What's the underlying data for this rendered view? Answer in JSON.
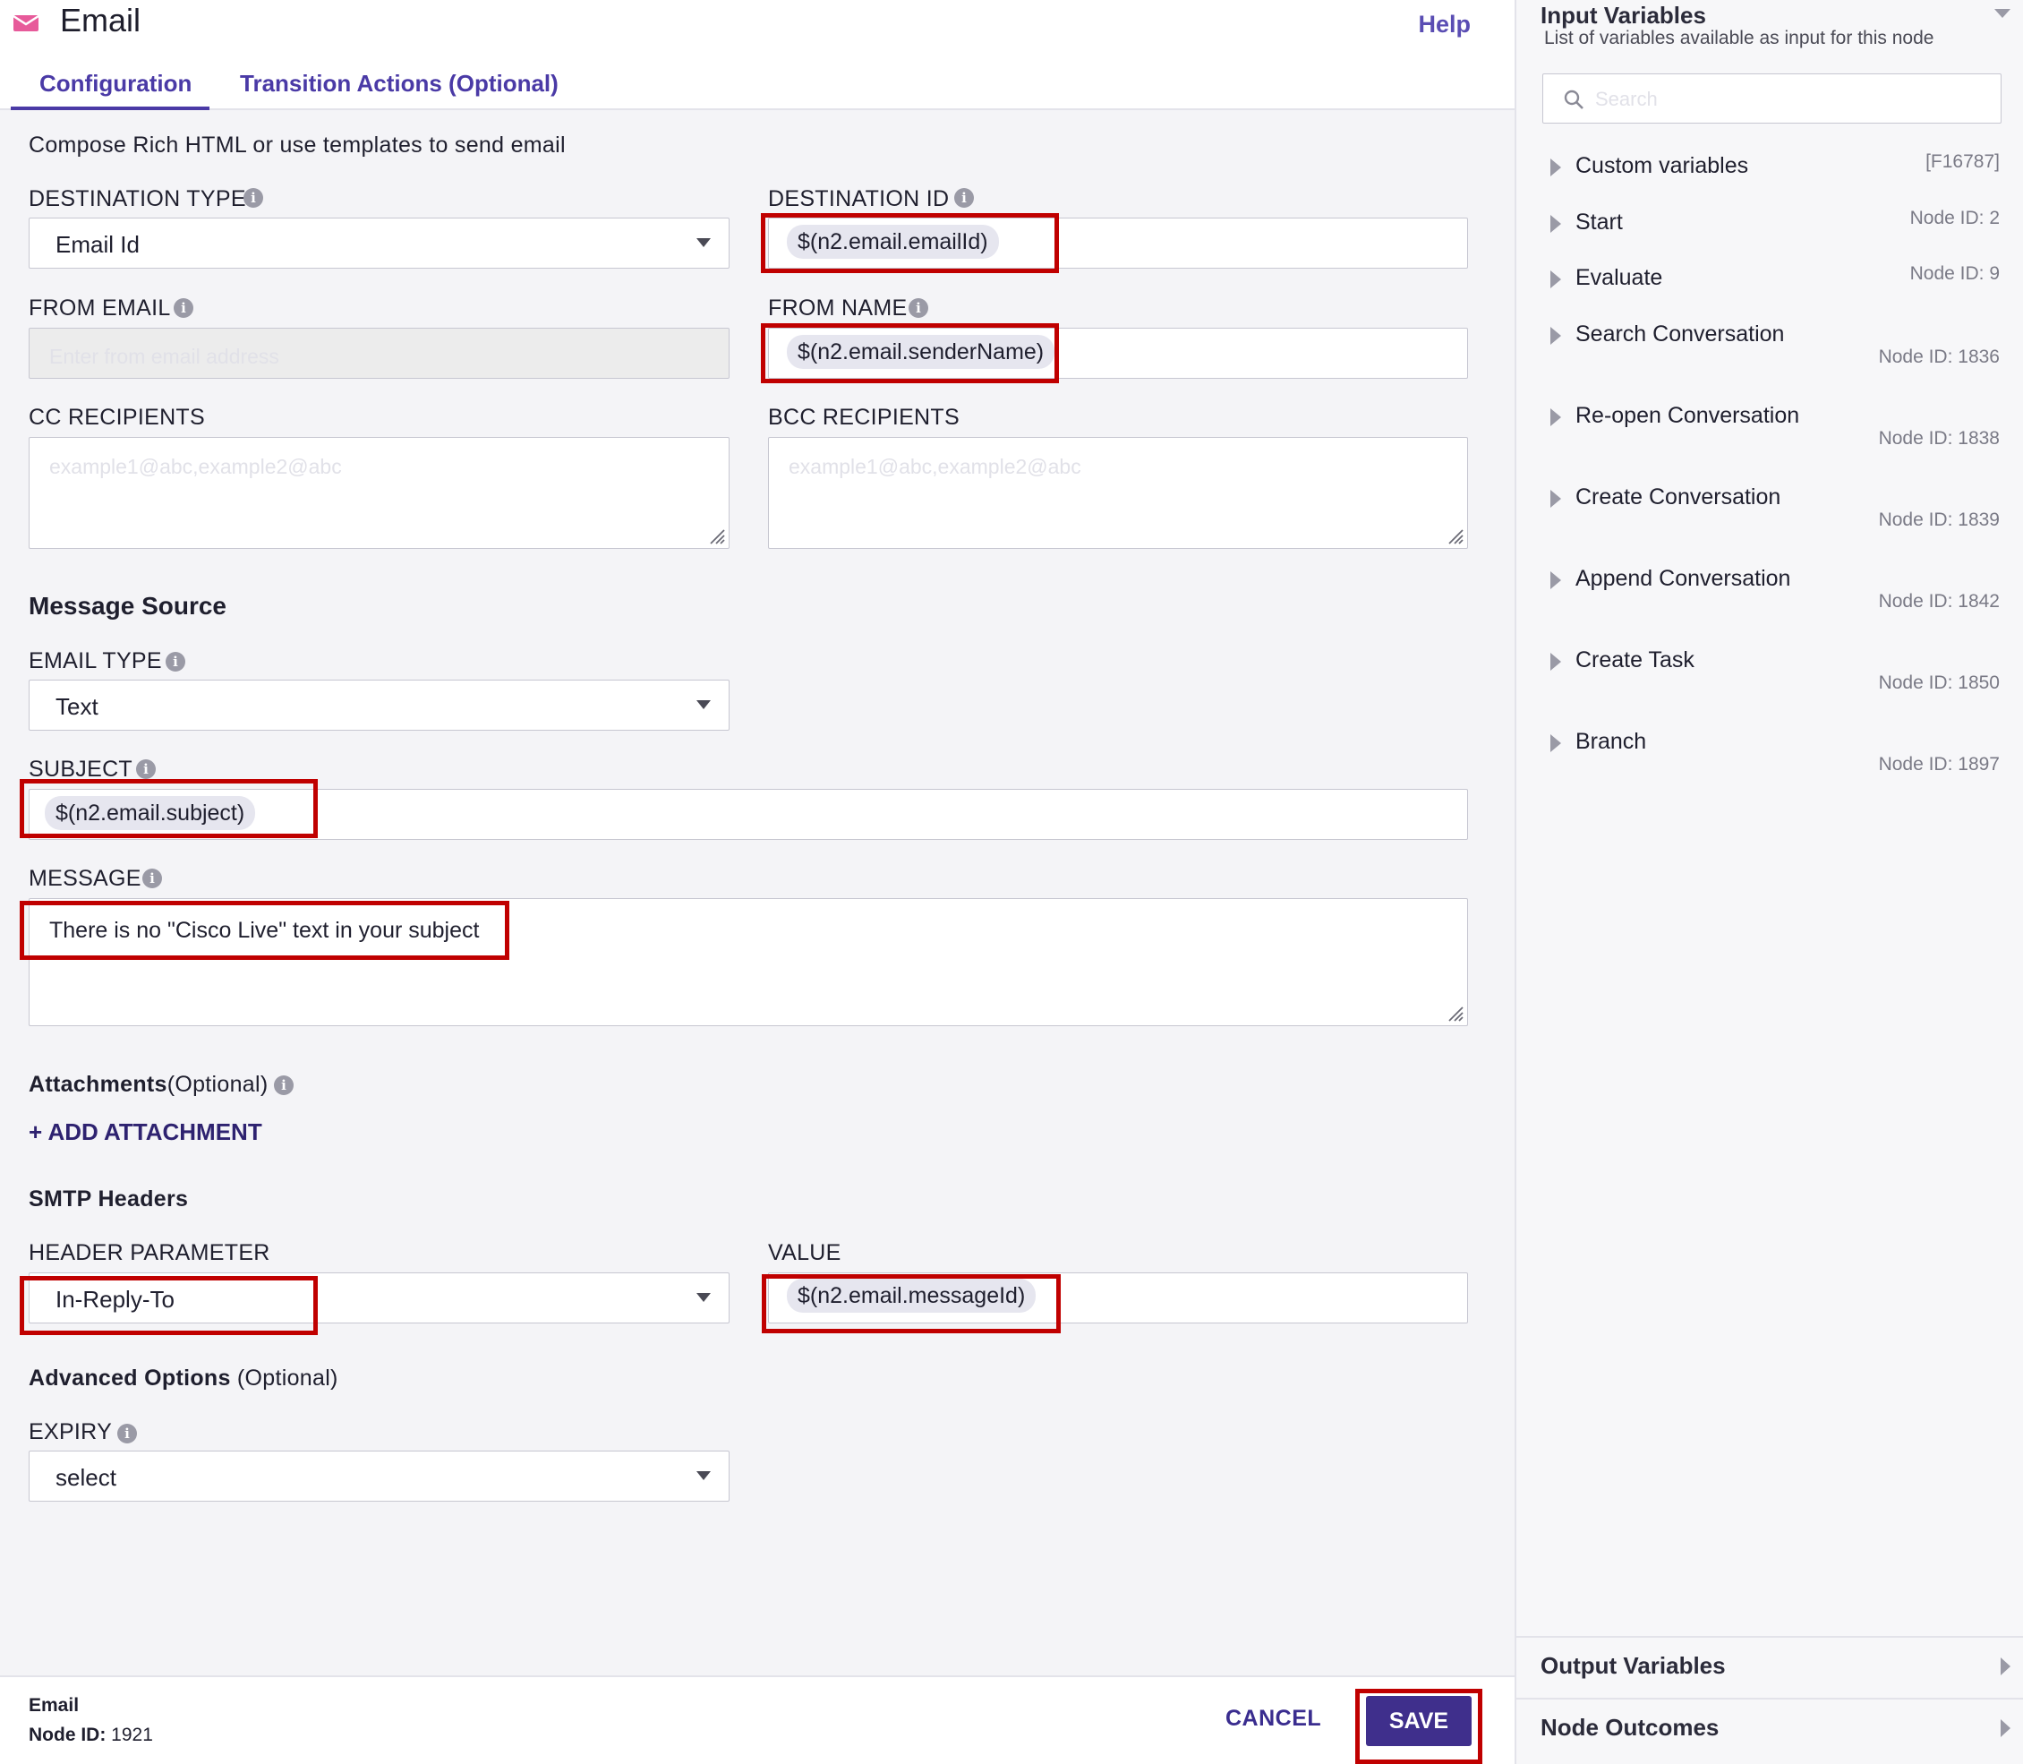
{
  "header": {
    "title": "Email",
    "help": "Help",
    "tabs": [
      "Configuration",
      "Transition Actions (Optional)"
    ]
  },
  "form": {
    "description": "Compose Rich HTML or use templates to send email",
    "destination_type": {
      "label": "DESTINATION TYPE",
      "value": "Email Id"
    },
    "destination_id": {
      "label": "DESTINATION ID",
      "value": "$(n2.email.emailId)"
    },
    "from_email": {
      "label": "FROM EMAIL",
      "placeholder": "Enter from email address"
    },
    "from_name": {
      "label": "FROM NAME",
      "value": "$(n2.email.senderName)"
    },
    "cc": {
      "label": "CC RECIPIENTS",
      "placeholder": "example1@abc,example2@abc"
    },
    "bcc": {
      "label": "BCC RECIPIENTS",
      "placeholder": "example1@abc,example2@abc"
    },
    "message_source_title": "Message Source",
    "email_type": {
      "label": "EMAIL TYPE",
      "value": "Text"
    },
    "subject": {
      "label": "SUBJECT",
      "value": "$(n2.email.subject)"
    },
    "message": {
      "label": "MESSAGE",
      "value": "There is no \"Cisco Live\" text in your subject"
    },
    "attachments": {
      "title": "Attachments",
      "optional": "(Optional)",
      "add": "+ ADD ATTACHMENT"
    },
    "smtp": {
      "title": "SMTP Headers",
      "param_label": "HEADER PARAMETER",
      "param_value": "In-Reply-To",
      "value_label": "VALUE",
      "value": "$(n2.email.messageId)"
    },
    "advanced": {
      "title": "Advanced Options",
      "optional": "(Optional)"
    },
    "expiry": {
      "label": "EXPIRY",
      "value": "select"
    }
  },
  "footer": {
    "name": "Email",
    "node_label": "Node ID:",
    "node_id": "1921",
    "cancel": "CANCEL",
    "save": "SAVE"
  },
  "sidebar": {
    "title": "Input Variables",
    "subtitle": "List of variables available as input for this node",
    "search_placeholder": "Search",
    "items": [
      {
        "name": "Custom variables",
        "node": "[F16787]"
      },
      {
        "name": "Start",
        "node": "Node ID: 2"
      },
      {
        "name": "Evaluate",
        "node": "Node ID: 9"
      },
      {
        "name": "Search Conversation",
        "node": "Node ID: 1836"
      },
      {
        "name": "Re-open Conversation",
        "node": "Node ID: 1838"
      },
      {
        "name": "Create Conversation",
        "node": "Node ID: 1839"
      },
      {
        "name": "Append Conversation",
        "node": "Node ID: 1842"
      },
      {
        "name": "Create Task",
        "node": "Node ID: 1850"
      },
      {
        "name": "Branch",
        "node": "Node ID: 1897"
      }
    ],
    "output_variables": "Output Variables",
    "node_outcomes": "Node Outcomes"
  },
  "colors": {
    "accent": "#4a3aa6",
    "save_button": "#3f2f8c",
    "highlight_box": "#c00000",
    "chip_bg": "#e6e6ef"
  },
  "icons": [
    "email-icon",
    "info-icon",
    "chevron-down-icon",
    "resize-grip-icon",
    "search-icon",
    "caret-right-icon"
  ]
}
